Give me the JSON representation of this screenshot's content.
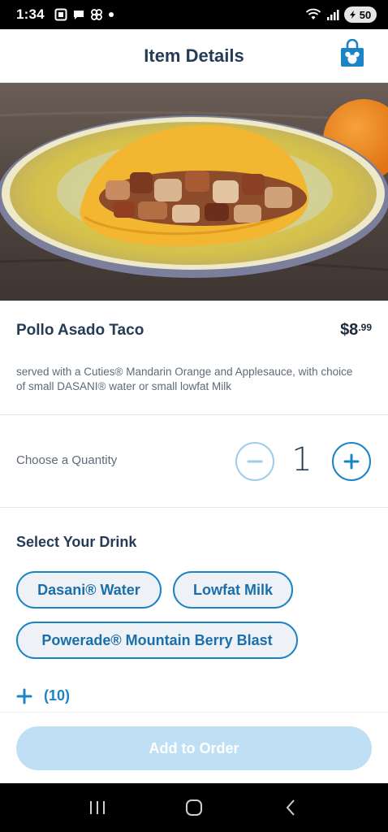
{
  "status_bar": {
    "time": "1:34",
    "battery": "50",
    "icons": [
      "screenshot-icon",
      "chat-icon",
      "pinwheel-icon",
      "dot-icon",
      "wifi-icon",
      "signal-icon",
      "battery-icon"
    ]
  },
  "header": {
    "title": "Item Details",
    "bag_icon": "mickey-shopping-bag-icon"
  },
  "item": {
    "name": "Pollo Asado Taco",
    "price_dollars": "$8",
    "price_cents": ".99",
    "description": "served with a Cuties® Mandarin Orange and Applesauce, with choice of small DASANI® water or small lowfat Milk"
  },
  "quantity": {
    "label": "Choose a Quantity",
    "value": "1",
    "minus_icon": "minus-circle-icon",
    "plus_icon": "plus-circle-icon"
  },
  "drinks": {
    "title": "Select Your Drink",
    "options": [
      "Dasani® Water",
      "Lowfat Milk",
      "Powerade® Mountain Berry Blast"
    ]
  },
  "more": {
    "count": "(10)",
    "icon": "plus-icon"
  },
  "footer": {
    "add_label": "Add to Order"
  },
  "colors": {
    "accent": "#1a84c6",
    "text_dark": "#253b56",
    "button_disabled": "#bfe0f4"
  },
  "nav_bar": {
    "icons": [
      "recent-apps-icon",
      "home-icon",
      "back-icon"
    ]
  }
}
